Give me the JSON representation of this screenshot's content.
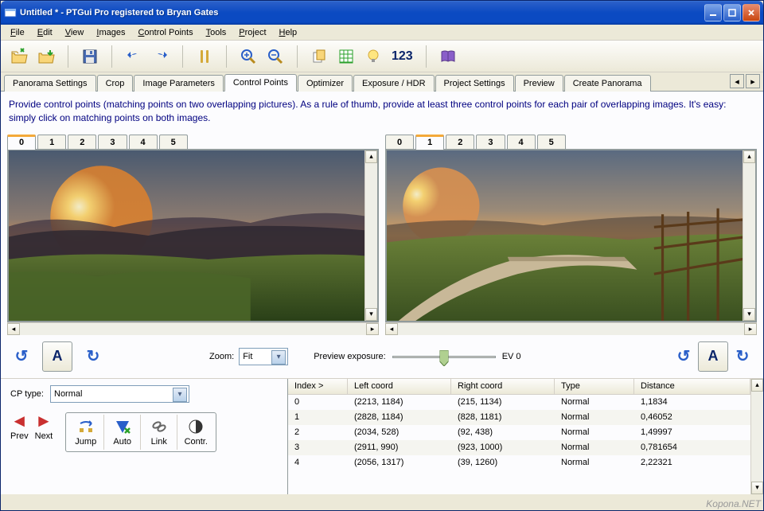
{
  "window": {
    "title": "Untitled * - PTGui Pro registered to Bryan Gates"
  },
  "menu": {
    "file": "File",
    "edit": "Edit",
    "view": "View",
    "images": "Images",
    "control_points": "Control Points",
    "tools": "Tools",
    "project": "Project",
    "help": "Help"
  },
  "tb_number": "123",
  "tabs": {
    "panorama": "Panorama Settings",
    "crop": "Crop",
    "image_params": "Image Parameters",
    "control_points": "Control Points",
    "optimizer": "Optimizer",
    "exposure": "Exposure / HDR",
    "project_settings": "Project Settings",
    "preview": "Preview",
    "create": "Create Panorama"
  },
  "hint": "Provide control points (matching points on two overlapping pictures). As a rule of thumb, provide at least three control points for each pair of overlapping images. It's easy: simply click on matching points on both images.",
  "left_tabs": [
    "0",
    "1",
    "2",
    "3",
    "4",
    "5"
  ],
  "left_active": "0",
  "right_tabs": [
    "0",
    "1",
    "2",
    "3",
    "4",
    "5"
  ],
  "right_active": "1",
  "zoom_label": "Zoom:",
  "zoom_value": "Fit",
  "exposure_label": "Preview exposure:",
  "ev_label": "EV 0",
  "cp_type_label": "CP type:",
  "cp_type_value": "Normal",
  "nav": {
    "prev": "Prev",
    "next": "Next",
    "jump": "Jump",
    "auto": "Auto",
    "link": "Link",
    "contr": "Contr."
  },
  "table": {
    "headers": {
      "index": "Index >",
      "left": "Left coord",
      "right": "Right coord",
      "type": "Type",
      "distance": "Distance"
    },
    "rows": [
      {
        "index": "0",
        "left": "(2213, 1184)",
        "right": "(215, 1134)",
        "type": "Normal",
        "distance": "1,1834"
      },
      {
        "index": "1",
        "left": "(2828, 1184)",
        "right": "(828, 1181)",
        "type": "Normal",
        "distance": "0,46052"
      },
      {
        "index": "2",
        "left": "(2034, 528)",
        "right": "(92, 438)",
        "type": "Normal",
        "distance": "1,49997"
      },
      {
        "index": "3",
        "left": "(2911, 990)",
        "right": "(923, 1000)",
        "type": "Normal",
        "distance": "0,781654"
      },
      {
        "index": "4",
        "left": "(2056, 1317)",
        "right": "(39, 1260)",
        "type": "Normal",
        "distance": "2,22321"
      }
    ]
  },
  "watermark": "Kopona.NET"
}
